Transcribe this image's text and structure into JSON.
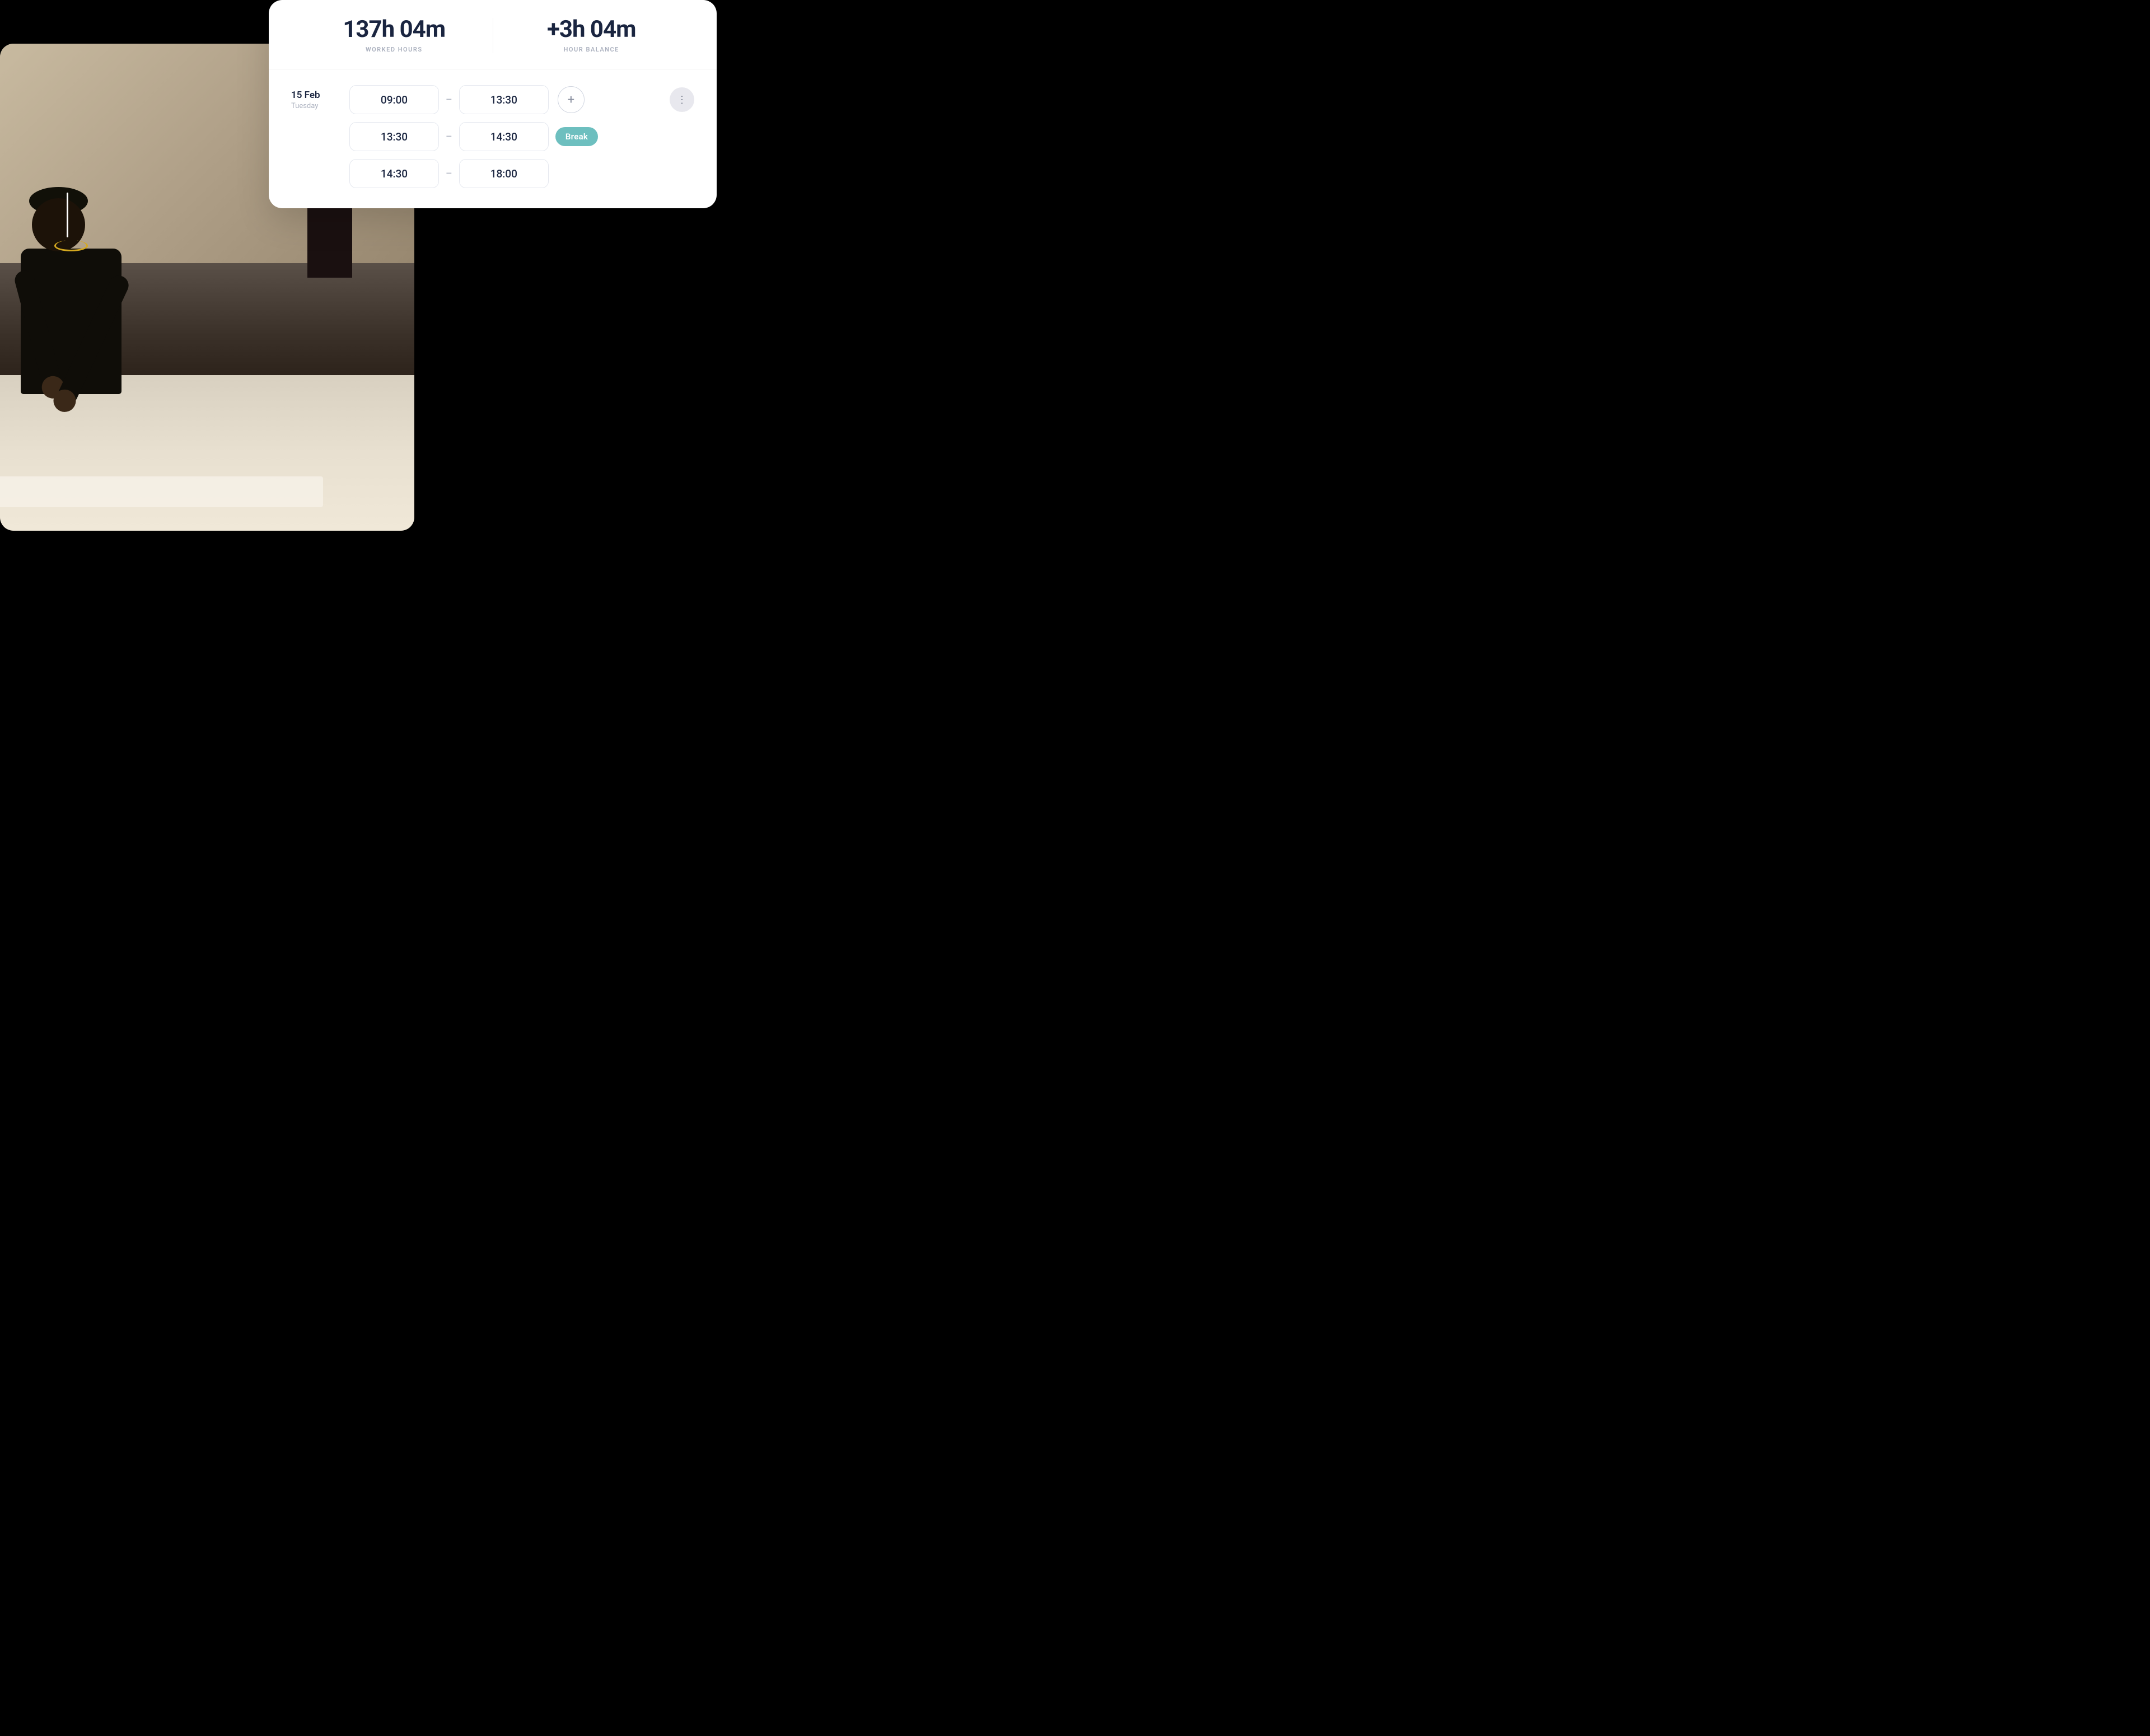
{
  "stats": {
    "worked_hours_value": "137h 04m",
    "worked_hours_label": "WORKED HOURS",
    "hour_balance_value": "+3h 04m",
    "hour_balance_label": "HOUR BALANCE"
  },
  "date_entry": {
    "date": "15 Feb",
    "weekday": "Tuesday",
    "entries": [
      {
        "start": "09:00",
        "end": "13:30",
        "badge": null,
        "has_add": true
      },
      {
        "start": "13:30",
        "end": "14:30",
        "badge": "Break",
        "has_add": false
      },
      {
        "start": "14:30",
        "end": "18:00",
        "badge": null,
        "has_add": false
      }
    ]
  },
  "more_button_dots": "⋮",
  "add_button_symbol": "+",
  "separator": "–",
  "colors": {
    "break_badge_bg": "#6dbfbf",
    "card_bg": "#ffffff",
    "text_dark": "#1a2540",
    "text_muted": "#aab0be",
    "border": "#e5e8ef",
    "more_btn_bg": "#e8e8ee"
  }
}
